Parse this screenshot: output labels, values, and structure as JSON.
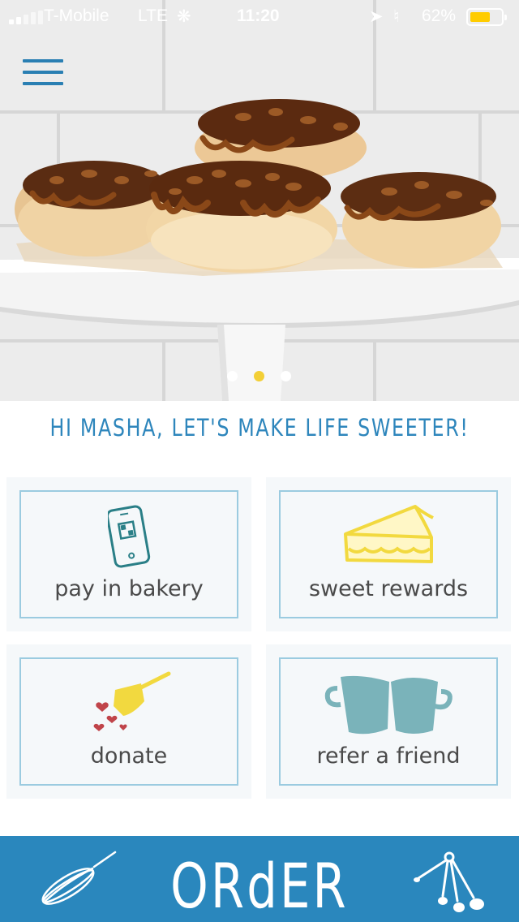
{
  "status_bar": {
    "carrier": "T-Mobile",
    "network": "LTE",
    "time": "11:20",
    "battery_percent": "62%",
    "battery_level": 0.62
  },
  "hero": {
    "carousel_page_count": 3,
    "carousel_active_index": 1
  },
  "greeting": "HI MASHA, LET'S MAKE LIFE SWEETER!",
  "tiles": [
    {
      "label": "pay in bakery",
      "icon": "phone-icon"
    },
    {
      "label": "sweet rewards",
      "icon": "pie-slice-icon"
    },
    {
      "label": "donate",
      "icon": "measuring-cup-hearts-icon"
    },
    {
      "label": "refer a friend",
      "icon": "two-mugs-icon"
    }
  ],
  "order_bar": {
    "label": "ORdER",
    "left_icon": "whisk-icon",
    "right_icon": "measuring-spoons-icon"
  },
  "colors": {
    "accent_blue": "#2a87bd",
    "tile_border": "#9bcbe0",
    "dot_active": "#f3cf36",
    "icon_teal": "#2a7f87",
    "icon_yellow": "#f2d93f",
    "heart_red": "#c0444a"
  }
}
